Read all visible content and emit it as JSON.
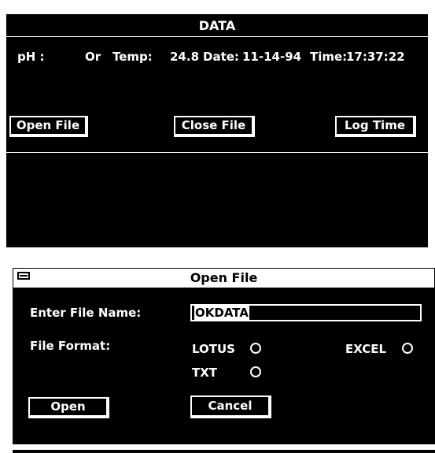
{
  "data_window": {
    "title": "DATA",
    "readout": {
      "ph_label": "pH :",
      "ph_value": "Or",
      "temp_label": "Temp:",
      "temp_value": "24.8",
      "date_label": "Date:",
      "date_value": "11-14-94",
      "time_label": "Time:",
      "time_value": "17:37:22"
    },
    "buttons": {
      "open_file": "Open File",
      "close_file": "Close File",
      "log_time": "Log Time"
    }
  },
  "open_file_dialog": {
    "title": "Open File",
    "file_name_label": "Enter File Name:",
    "file_name_value": "OKDATA",
    "file_format_label": "File Format:",
    "formats": {
      "lotus": "LOTUS",
      "excel": "EXCEL",
      "txt": "TXT"
    },
    "buttons": {
      "open": "Open",
      "cancel": "Cancel"
    }
  },
  "colors": {
    "window_bg": "#000000",
    "text": "#ffffff",
    "page_bg": "#ffffff"
  },
  "icons": {
    "system_menu": "system-menu-icon",
    "radio": "radio-button-icon"
  }
}
